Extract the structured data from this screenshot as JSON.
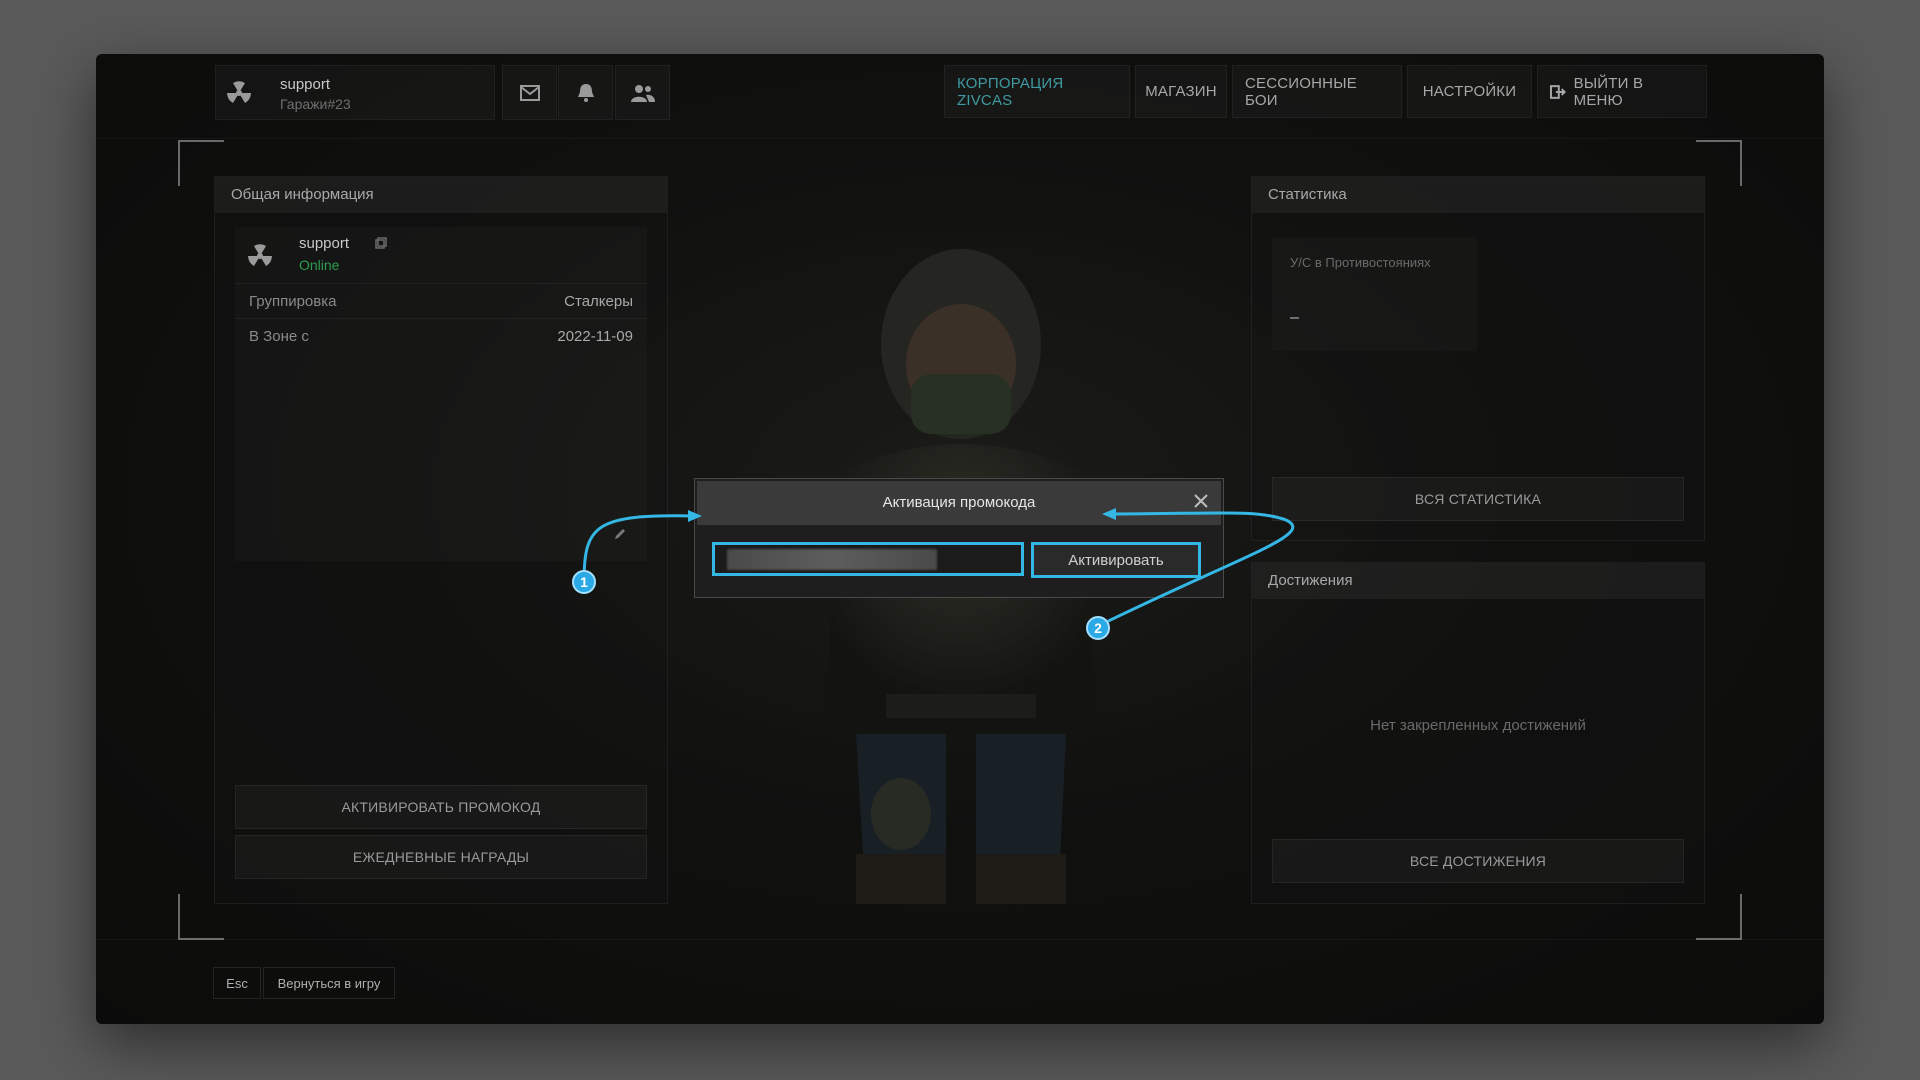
{
  "header": {
    "user_name": "support",
    "user_sub": "Гаражи#23",
    "nav": [
      {
        "label": "КОРПОРАЦИЯ ZIVCAS",
        "active": true
      },
      {
        "label": "МАГАЗИН"
      },
      {
        "label": "СЕССИОННЫЕ БОИ"
      },
      {
        "label": "НАСТРОЙКИ"
      },
      {
        "label": "ВЫЙТИ В МЕНЮ"
      }
    ]
  },
  "general_info": {
    "title": "Общая информация",
    "player_name": "support",
    "status": "Online",
    "rows": [
      {
        "key": "Группировка",
        "value": "Сталкеры"
      },
      {
        "key": "В Зоне с",
        "value": "2022-11-09"
      }
    ],
    "btn_promo": "АКТИВИРОВАТЬ ПРОМОКОД",
    "btn_daily": "ЕЖЕДНЕВНЫЕ НАГРАДЫ"
  },
  "stats": {
    "title": "Статистика",
    "card_label": "У/С в Противостояниях",
    "card_value": "–",
    "btn_all": "ВСЯ СТАТИСТИКА"
  },
  "achievements": {
    "title": "Достижения",
    "empty": "Нет закрепленных достижений",
    "btn_all": "ВСЕ ДОСТИЖЕНИЯ"
  },
  "modal": {
    "title": "Активация промокода",
    "activate_label": "Активировать"
  },
  "markers": [
    "1",
    "2"
  ],
  "footer": {
    "esc": "Esc",
    "back": "Вернуться в игру"
  },
  "colors": {
    "accent": "#35b7e6",
    "online": "#2f9e4f",
    "nav_active": "#3e9aa0"
  }
}
